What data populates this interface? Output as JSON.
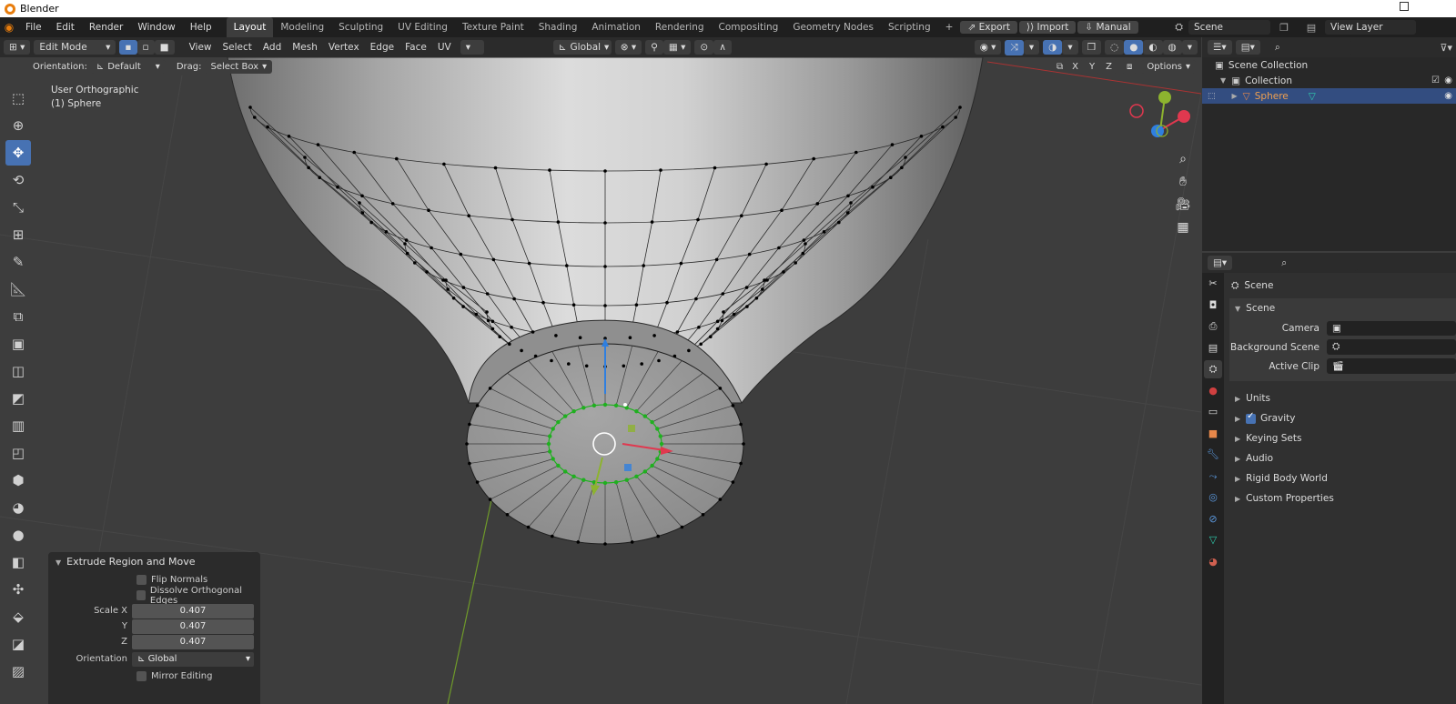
{
  "window": {
    "title": "Blender"
  },
  "menu": [
    "File",
    "Edit",
    "Render",
    "Window",
    "Help"
  ],
  "workspaces": [
    "Layout",
    "Modeling",
    "Sculpting",
    "UV Editing",
    "Texture Paint",
    "Shading",
    "Animation",
    "Rendering",
    "Compositing",
    "Geometry Nodes",
    "Scripting"
  ],
  "topbar": {
    "add_label": "+",
    "export": "Export",
    "import": "Import",
    "manual": "Manual",
    "scene": "Scene",
    "view_layer": "View Layer"
  },
  "view_header": {
    "mode": "Edit Mode",
    "menus": [
      "View",
      "Select",
      "Add",
      "Mesh",
      "Vertex",
      "Edge",
      "Face",
      "UV"
    ],
    "transform": "Global"
  },
  "sub_header": {
    "orientation_label": "Orientation:",
    "orientation_value": "Default",
    "drag_label": "Drag:",
    "drag_value": "Select Box",
    "axes": [
      "X",
      "Y",
      "Z"
    ],
    "options": "Options"
  },
  "viewport_info": {
    "view": "User Orthographic",
    "object": "(1) Sphere"
  },
  "operator_panel": {
    "title": "Extrude Region and Move",
    "flip_normals": "Flip Normals",
    "dissolve": "Dissolve Orthogonal Edges",
    "scale_x_label": "Scale X",
    "scale_y_label": "Y",
    "scale_z_label": "Z",
    "scale_x": "0.407",
    "scale_y": "0.407",
    "scale_z": "0.407",
    "orientation_label": "Orientation",
    "orientation_value": "Global",
    "mirror": "Mirror Editing"
  },
  "outliner": {
    "scene_collection": "Scene Collection",
    "collection": "Collection",
    "sphere": "Sphere"
  },
  "properties": {
    "header": "Scene",
    "panel": "Scene",
    "camera_label": "Camera",
    "bg_scene_label": "Background Scene",
    "active_clip_label": "Active Clip",
    "sections": [
      "Units",
      "Gravity",
      "Keying Sets",
      "Audio",
      "Rigid Body World",
      "Custom Properties"
    ]
  },
  "colors": {
    "accent": "#4772b3",
    "selected_vertex": "#1fb01f",
    "x_axis": "#e0384f",
    "y_axis": "#8db32f",
    "z_axis": "#2f7fe0"
  }
}
